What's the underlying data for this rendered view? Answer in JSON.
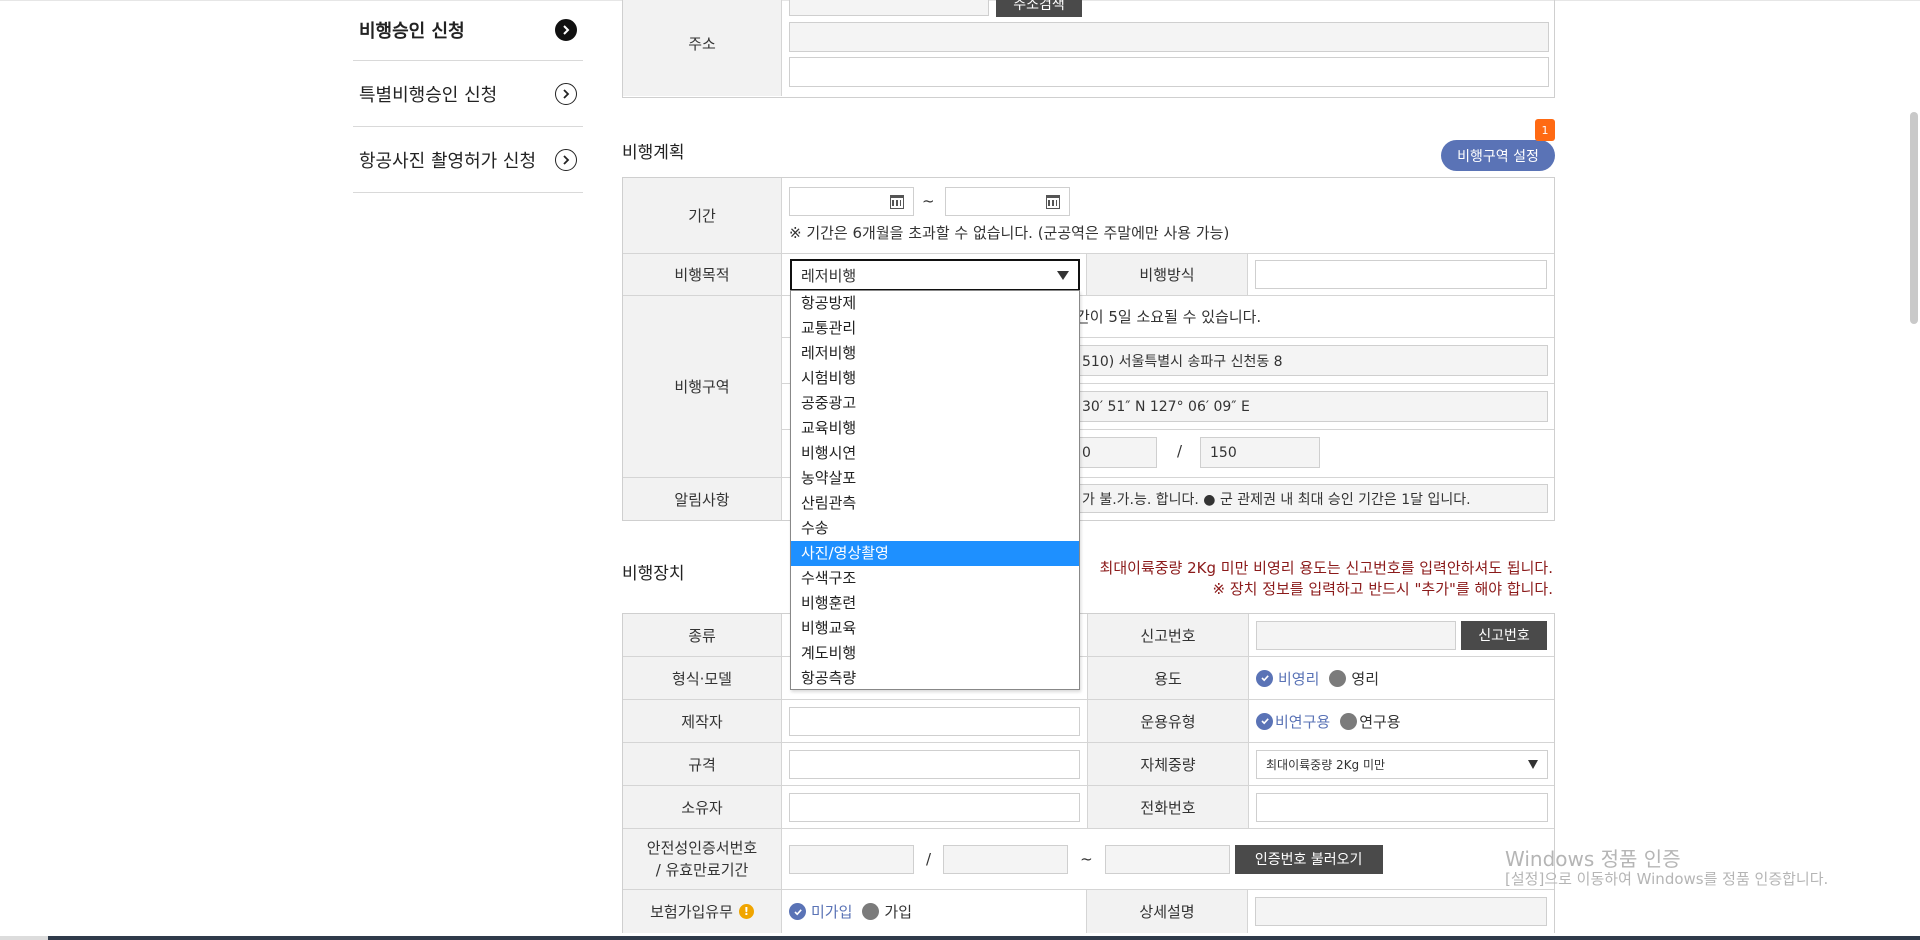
{
  "sidebar": {
    "items": [
      {
        "label": "비행승인 신청"
      },
      {
        "label": "특별비행승인 신청"
      },
      {
        "label": "항공사진 촬영허가 신청"
      }
    ]
  },
  "address": {
    "label": "주소",
    "search_button": "주소검색"
  },
  "flight_plan": {
    "title": "비행계획",
    "zone_button": "비행구역 설정",
    "badge_count": "1",
    "period_label": "기간",
    "period_sep": "~",
    "period_note": "※ 기간은 6개월을 초과할 수 없습니다. (군공역은 주말에만 사용 가능)",
    "purpose_label": "비행목적",
    "purpose_selected": "레저비행",
    "method_label": "비행방식",
    "zone_label": "비행구역",
    "zone_note": "간이 5일 소요될 수 있습니다.",
    "zone_address": "510) 서울특별시 송파구 신천동 8",
    "zone_coords": "30′ 51″ N 127° 06′ 09″ E",
    "zone_alt_left": "0",
    "zone_alt_sep": "/",
    "zone_alt_right": "150",
    "notice_label": "알림사항",
    "notice_text": "가 불.가.능. 합니다. ● 군 관제권 내 최대 승인 기간은 1달 입니다."
  },
  "dropdown": {
    "options": [
      "항공방제",
      "교통관리",
      "레저비행",
      "시험비행",
      "공중광고",
      "교육비행",
      "비행시연",
      "농약살포",
      "산림관측",
      "수송",
      "사진/영상촬영",
      "수색구조",
      "비행훈련",
      "비행교육",
      "계도비행",
      "항공측량"
    ],
    "highlighted": "사진/영상촬영"
  },
  "device": {
    "title": "비행장치",
    "note1": "최대이륙중량 2Kg 미만 비영리 용도는 신고번호를 입력안하셔도 됩니다.",
    "note2": "※ 장치 정보를 입력하고 반드시 \"추가\"를 해야 합니다.",
    "type_label": "종류",
    "reg_label": "신고번호",
    "reg_button": "신고번호",
    "model_label": "형식·모델",
    "usage_label": "용도",
    "usage_opt1": "비영리",
    "usage_opt2": "영리",
    "maker_label": "제작자",
    "optype_label": "운용유형",
    "optype_opt1": "비연구용",
    "optype_opt2": "연구용",
    "spec_label": "규격",
    "weight_label": "자체중량",
    "weight_selected": "최대이륙중량 2Kg 미만",
    "owner_label": "소유자",
    "phone_label": "전화번호",
    "cert_label_1": "안전성인증서번호",
    "cert_label_2": "/ 유효만료기간",
    "cert_sep1": "/",
    "cert_sep2": "~",
    "cert_button": "인증번호 불러오기",
    "insurance_label": "보험가입유무",
    "ins_opt1": "미가입",
    "ins_opt2": "가입",
    "detail_label": "상세설명"
  },
  "watermark": {
    "line1": "Windows 정품 인증",
    "line2": "[설정]으로 이동하여 Windows를 정품 인증합니다."
  },
  "colors": {
    "accent": "#5a73b6",
    "highlight": "#1e90ff",
    "badge": "#ff6a13",
    "warning": "#8b1a1a"
  }
}
